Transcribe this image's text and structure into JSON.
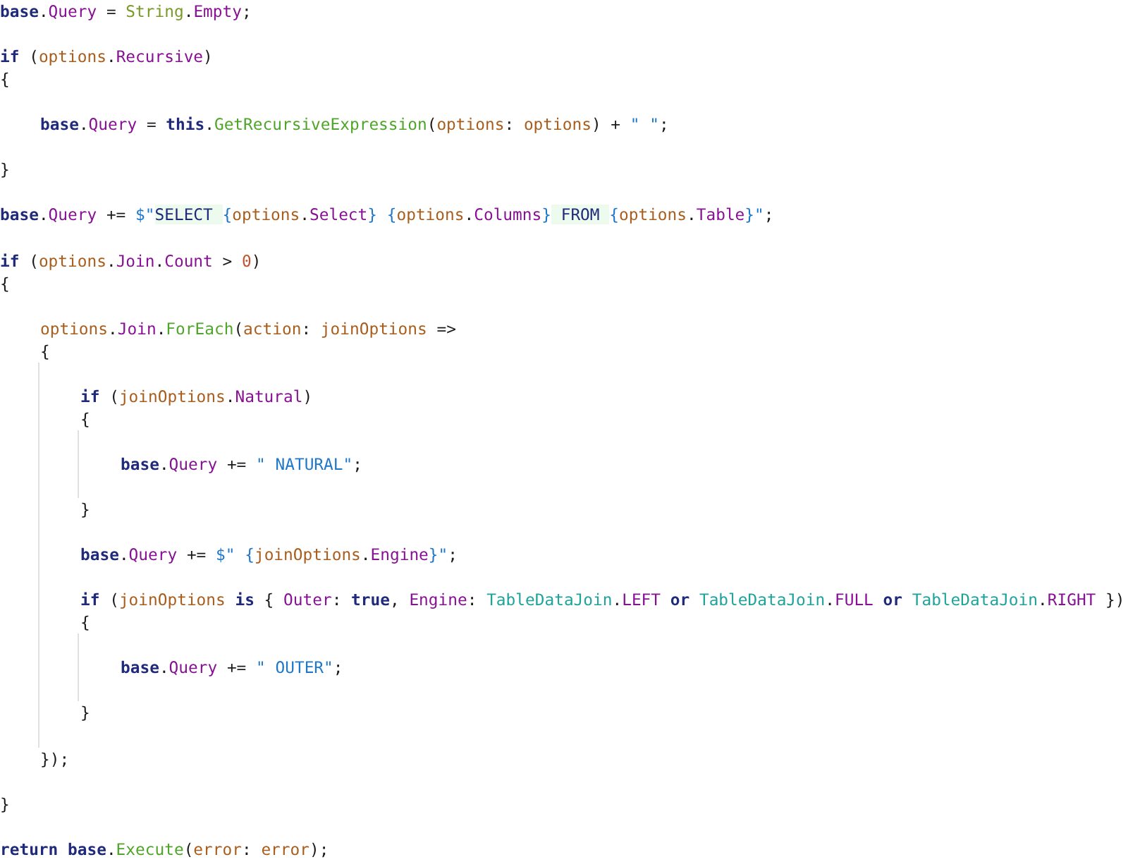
{
  "code": [
    {
      "kind": "line",
      "tokens": [
        {
          "kind": "kw",
          "text": "base"
        },
        {
          "kind": "punct",
          "text": "."
        },
        {
          "kind": "member",
          "text": "Query"
        },
        {
          "kind": "punct",
          "text": " = "
        },
        {
          "kind": "cls",
          "text": "String"
        },
        {
          "kind": "punct",
          "text": "."
        },
        {
          "kind": "member",
          "text": "Empty"
        },
        {
          "kind": "punct",
          "text": ";"
        }
      ]
    },
    {
      "kind": "blank"
    },
    {
      "kind": "line",
      "tokens": [
        {
          "kind": "kw",
          "text": "if"
        },
        {
          "kind": "punct",
          "text": " ("
        },
        {
          "kind": "local",
          "text": "options"
        },
        {
          "kind": "punct",
          "text": "."
        },
        {
          "kind": "member",
          "text": "Recursive"
        },
        {
          "kind": "punct",
          "text": ")"
        }
      ]
    },
    {
      "kind": "line",
      "tokens": [
        {
          "kind": "punct",
          "text": "{"
        }
      ]
    },
    {
      "kind": "block",
      "children": [
        {
          "kind": "blank"
        },
        {
          "kind": "line",
          "tokens": [
            {
              "kind": "kw",
              "text": "base"
            },
            {
              "kind": "punct",
              "text": "."
            },
            {
              "kind": "member",
              "text": "Query"
            },
            {
              "kind": "punct",
              "text": " = "
            },
            {
              "kind": "kw",
              "text": "this"
            },
            {
              "kind": "punct",
              "text": "."
            },
            {
              "kind": "method",
              "text": "GetRecursiveExpression"
            },
            {
              "kind": "punct",
              "text": "("
            },
            {
              "kind": "local",
              "text": "options"
            },
            {
              "kind": "punct",
              "text": ": "
            },
            {
              "kind": "local",
              "text": "options"
            },
            {
              "kind": "punct",
              "text": ") + "
            },
            {
              "kind": "str",
              "text": "\" \""
            },
            {
              "kind": "punct",
              "text": ";"
            }
          ]
        },
        {
          "kind": "blank"
        }
      ]
    },
    {
      "kind": "line",
      "tokens": [
        {
          "kind": "punct",
          "text": "}"
        }
      ]
    },
    {
      "kind": "blank"
    },
    {
      "kind": "line",
      "tokens": [
        {
          "kind": "kw",
          "text": "base"
        },
        {
          "kind": "punct",
          "text": "."
        },
        {
          "kind": "member",
          "text": "Query"
        },
        {
          "kind": "punct",
          "text": " += "
        },
        {
          "kind": "str",
          "text": "$\""
        },
        {
          "kind": "istr",
          "text": "SELECT "
        },
        {
          "kind": "str",
          "text": "{"
        },
        {
          "kind": "local",
          "text": "options"
        },
        {
          "kind": "punct",
          "text": "."
        },
        {
          "kind": "member",
          "text": "Select"
        },
        {
          "kind": "str",
          "text": "} {"
        },
        {
          "kind": "local",
          "text": "options"
        },
        {
          "kind": "punct",
          "text": "."
        },
        {
          "kind": "member",
          "text": "Columns"
        },
        {
          "kind": "str",
          "text": "}"
        },
        {
          "kind": "istr",
          "text": " FROM "
        },
        {
          "kind": "str",
          "text": "{"
        },
        {
          "kind": "local",
          "text": "options"
        },
        {
          "kind": "punct",
          "text": "."
        },
        {
          "kind": "member",
          "text": "Table"
        },
        {
          "kind": "str",
          "text": "}\""
        },
        {
          "kind": "punct",
          "text": ";"
        }
      ]
    },
    {
      "kind": "blank"
    },
    {
      "kind": "line",
      "tokens": [
        {
          "kind": "kw",
          "text": "if"
        },
        {
          "kind": "punct",
          "text": " ("
        },
        {
          "kind": "local",
          "text": "options"
        },
        {
          "kind": "punct",
          "text": "."
        },
        {
          "kind": "member",
          "text": "Join"
        },
        {
          "kind": "punct",
          "text": "."
        },
        {
          "kind": "member",
          "text": "Count"
        },
        {
          "kind": "punct",
          "text": " > "
        },
        {
          "kind": "num",
          "text": "0"
        },
        {
          "kind": "punct",
          "text": ")"
        }
      ]
    },
    {
      "kind": "line",
      "tokens": [
        {
          "kind": "punct",
          "text": "{"
        }
      ]
    },
    {
      "kind": "block",
      "children": [
        {
          "kind": "blank"
        },
        {
          "kind": "line",
          "tokens": [
            {
              "kind": "local",
              "text": "options"
            },
            {
              "kind": "punct",
              "text": "."
            },
            {
              "kind": "member",
              "text": "Join"
            },
            {
              "kind": "punct",
              "text": "."
            },
            {
              "kind": "method",
              "text": "ForEach"
            },
            {
              "kind": "punct",
              "text": "("
            },
            {
              "kind": "local",
              "text": "action"
            },
            {
              "kind": "punct",
              "text": ": "
            },
            {
              "kind": "local",
              "text": "joinOptions"
            },
            {
              "kind": "punct",
              "text": " =>"
            }
          ]
        },
        {
          "kind": "line",
          "tokens": [
            {
              "kind": "punct",
              "text": "{"
            }
          ]
        },
        {
          "kind": "block",
          "guide": true,
          "children": [
            {
              "kind": "blank"
            },
            {
              "kind": "line",
              "tokens": [
                {
                  "kind": "kw",
                  "text": "if"
                },
                {
                  "kind": "punct",
                  "text": " ("
                },
                {
                  "kind": "local",
                  "text": "joinOptions"
                },
                {
                  "kind": "punct",
                  "text": "."
                },
                {
                  "kind": "member",
                  "text": "Natural"
                },
                {
                  "kind": "punct",
                  "text": ")"
                }
              ]
            },
            {
              "kind": "line",
              "tokens": [
                {
                  "kind": "punct",
                  "text": "{"
                }
              ]
            },
            {
              "kind": "block",
              "guide": true,
              "children": [
                {
                  "kind": "blank"
                },
                {
                  "kind": "line",
                  "tokens": [
                    {
                      "kind": "kw",
                      "text": "base"
                    },
                    {
                      "kind": "punct",
                      "text": "."
                    },
                    {
                      "kind": "member",
                      "text": "Query"
                    },
                    {
                      "kind": "punct",
                      "text": " += "
                    },
                    {
                      "kind": "str",
                      "text": "\" NATURAL\""
                    },
                    {
                      "kind": "punct",
                      "text": ";"
                    }
                  ]
                },
                {
                  "kind": "blank"
                }
              ]
            },
            {
              "kind": "line",
              "tokens": [
                {
                  "kind": "punct",
                  "text": "}"
                }
              ]
            },
            {
              "kind": "blank"
            },
            {
              "kind": "line",
              "tokens": [
                {
                  "kind": "kw",
                  "text": "base"
                },
                {
                  "kind": "punct",
                  "text": "."
                },
                {
                  "kind": "member",
                  "text": "Query"
                },
                {
                  "kind": "punct",
                  "text": " += "
                },
                {
                  "kind": "str",
                  "text": "$\" {"
                },
                {
                  "kind": "local",
                  "text": "joinOptions"
                },
                {
                  "kind": "punct",
                  "text": "."
                },
                {
                  "kind": "member",
                  "text": "Engine"
                },
                {
                  "kind": "str",
                  "text": "}\""
                },
                {
                  "kind": "punct",
                  "text": ";"
                }
              ]
            },
            {
              "kind": "blank"
            },
            {
              "kind": "line",
              "tokens": [
                {
                  "kind": "kw",
                  "text": "if"
                },
                {
                  "kind": "punct",
                  "text": " ("
                },
                {
                  "kind": "local",
                  "text": "joinOptions"
                },
                {
                  "kind": "kw",
                  "text": " is"
                },
                {
                  "kind": "punct",
                  "text": " { "
                },
                {
                  "kind": "member",
                  "text": "Outer"
                },
                {
                  "kind": "punct",
                  "text": ": "
                },
                {
                  "kind": "kw",
                  "text": "true"
                },
                {
                  "kind": "punct",
                  "text": ", "
                },
                {
                  "kind": "member",
                  "text": "Engine"
                },
                {
                  "kind": "punct",
                  "text": ": "
                },
                {
                  "kind": "type",
                  "text": "TableDataJoin"
                },
                {
                  "kind": "punct",
                  "text": "."
                },
                {
                  "kind": "member",
                  "text": "LEFT"
                },
                {
                  "kind": "kw",
                  "text": " or"
                },
                {
                  "kind": "type",
                  "text": " TableDataJoin"
                },
                {
                  "kind": "punct",
                  "text": "."
                },
                {
                  "kind": "member",
                  "text": "FULL"
                },
                {
                  "kind": "kw",
                  "text": " or"
                },
                {
                  "kind": "type",
                  "text": " TableDataJoin"
                },
                {
                  "kind": "punct",
                  "text": "."
                },
                {
                  "kind": "member",
                  "text": "RIGHT"
                },
                {
                  "kind": "punct",
                  "text": " })"
                }
              ]
            },
            {
              "kind": "line",
              "tokens": [
                {
                  "kind": "punct",
                  "text": "{"
                }
              ]
            },
            {
              "kind": "block",
              "guide": true,
              "children": [
                {
                  "kind": "blank"
                },
                {
                  "kind": "line",
                  "tokens": [
                    {
                      "kind": "kw",
                      "text": "base"
                    },
                    {
                      "kind": "punct",
                      "text": "."
                    },
                    {
                      "kind": "member",
                      "text": "Query"
                    },
                    {
                      "kind": "punct",
                      "text": " += "
                    },
                    {
                      "kind": "str",
                      "text": "\" OUTER\""
                    },
                    {
                      "kind": "punct",
                      "text": ";"
                    }
                  ]
                },
                {
                  "kind": "blank"
                }
              ]
            },
            {
              "kind": "line",
              "tokens": [
                {
                  "kind": "punct",
                  "text": "}"
                }
              ]
            },
            {
              "kind": "blank"
            }
          ]
        },
        {
          "kind": "line",
          "tokens": [
            {
              "kind": "punct",
              "text": "});"
            }
          ]
        },
        {
          "kind": "blank"
        }
      ]
    },
    {
      "kind": "line",
      "tokens": [
        {
          "kind": "punct",
          "text": "}"
        }
      ]
    },
    {
      "kind": "blank"
    },
    {
      "kind": "line",
      "tokens": [
        {
          "kind": "kw",
          "text": "return base"
        },
        {
          "kind": "punct",
          "text": "."
        },
        {
          "kind": "method",
          "text": "Execute"
        },
        {
          "kind": "punct",
          "text": "("
        },
        {
          "kind": "local",
          "text": "error"
        },
        {
          "kind": "punct",
          "text": ": "
        },
        {
          "kind": "local",
          "text": "error"
        },
        {
          "kind": "punct",
          "text": ");"
        }
      ]
    }
  ]
}
